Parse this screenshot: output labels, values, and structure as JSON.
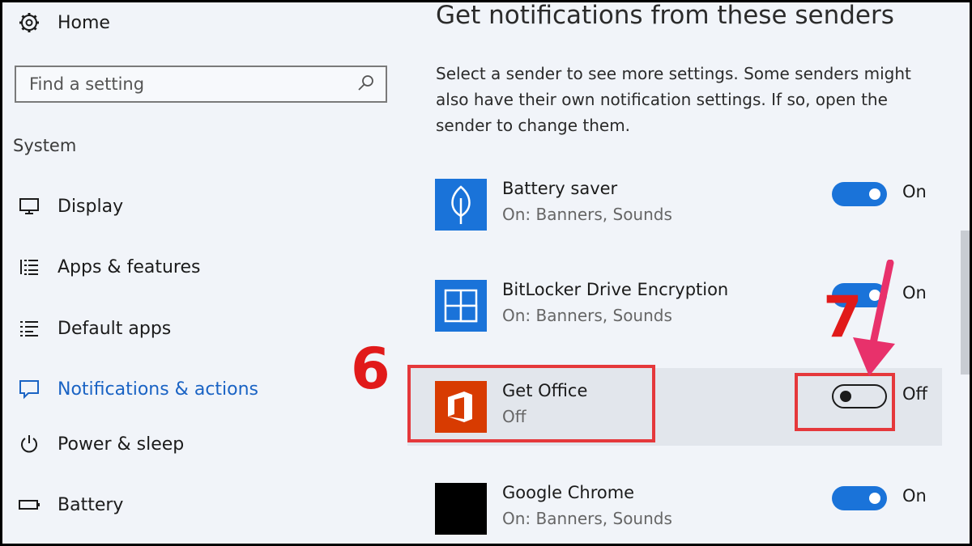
{
  "nav": {
    "home": "Home",
    "search": {
      "placeholder": "Find a setting"
    },
    "section": "System",
    "items": [
      {
        "label": "Display",
        "icon": "monitor-icon"
      },
      {
        "label": "Apps & features",
        "icon": "list-icon"
      },
      {
        "label": "Default apps",
        "icon": "default-apps-icon"
      },
      {
        "label": "Notifications & actions",
        "icon": "notification-icon",
        "active": true
      },
      {
        "label": "Power & sleep",
        "icon": "power-icon"
      },
      {
        "label": "Battery",
        "icon": "battery-icon"
      }
    ]
  },
  "main": {
    "heading": "Get notifications from these senders",
    "description": "Select a sender to see more settings. Some senders might also have their own notification settings. If so, open the sender to change them.",
    "senders": [
      {
        "name": "Battery saver",
        "sub": "On: Banners, Sounds",
        "state": "On"
      },
      {
        "name": "BitLocker Drive Encryption",
        "sub": "On: Banners, Sounds",
        "state": "On"
      },
      {
        "name": "Get Office",
        "sub": "Off",
        "state": "Off"
      },
      {
        "name": "Google Chrome",
        "sub": "On: Banners, Sounds",
        "state": "On"
      }
    ]
  },
  "annotations": {
    "step_sender": "6",
    "step_toggle": "7"
  },
  "colors": {
    "accent": "#1a73d9",
    "nav_active": "#1a63c4",
    "annotation": "#e5383b",
    "office_tile": "#d83b01"
  }
}
